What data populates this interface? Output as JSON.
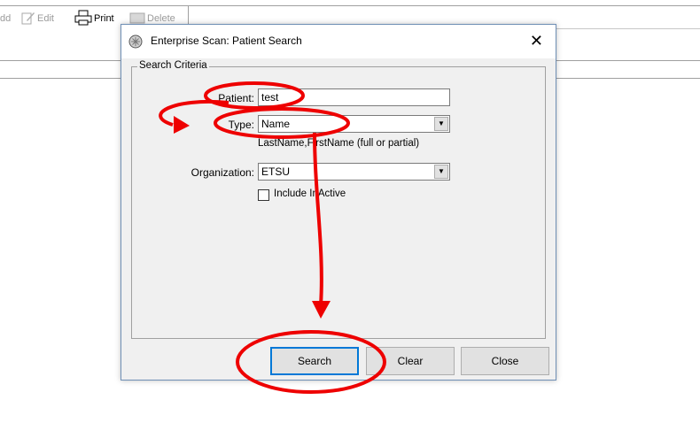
{
  "toolbar": {
    "add_label": "dd",
    "edit_label": "Edit",
    "print_label": "Print",
    "delete_label": "Delete"
  },
  "dialog": {
    "title": "Enterprise Scan: Patient Search",
    "close_glyph": "✕",
    "group_title": "Search Criteria",
    "patient_label": "Patient:",
    "patient_value": "test",
    "type_label": "Type:",
    "type_value": "Name",
    "type_hint": "LastName,FirstName (full or partial)",
    "organization_label": "Organization:",
    "organization_value": "ETSU",
    "include_inactive_label": "Include InActive",
    "include_inactive_checked": false,
    "search_button": "Search",
    "clear_button": "Clear",
    "close_button": "Close"
  },
  "annotation": {
    "color": "#ee0000"
  }
}
